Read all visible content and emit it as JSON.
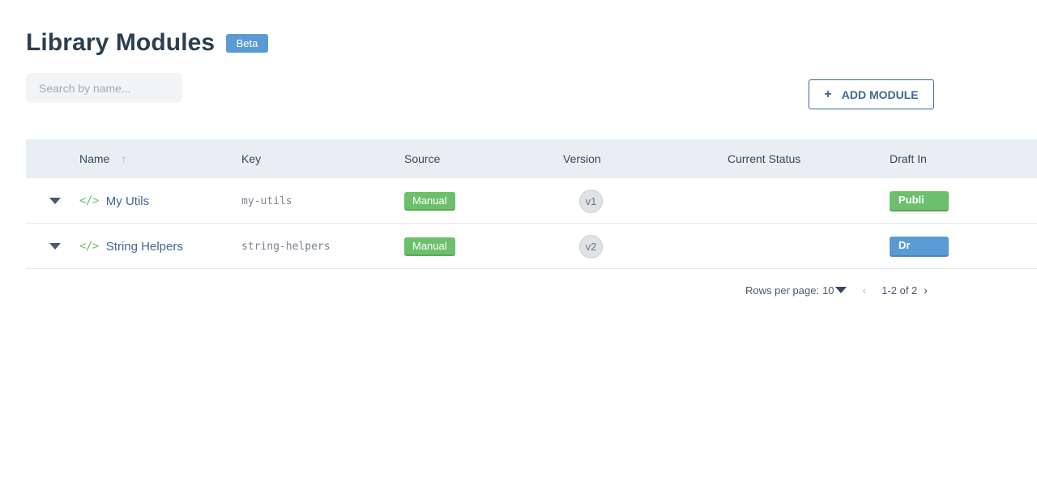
{
  "header": {
    "title": "Library Modules",
    "badge": "Beta"
  },
  "search": {
    "placeholder": "Search by name...",
    "value": ""
  },
  "toolbar": {
    "add_icon": "+",
    "add_label": "ADD MODULE"
  },
  "table": {
    "columns": {
      "name": "Name",
      "sort_icon": "↑",
      "key": "Key",
      "source": "Source",
      "version": "Version",
      "current_status": "Current Status",
      "draft_in": "Draft In"
    },
    "rows": [
      {
        "icon": "</>",
        "name": "My Utils",
        "key": "my-utils",
        "source": "Manual",
        "version": "v1",
        "current_status": "",
        "draft_in": "Publi"
      },
      {
        "icon": "</>",
        "name": "String Helpers",
        "key": "string-helpers",
        "source": "Manual",
        "version": "v2",
        "current_status": "",
        "draft_in": "Dr"
      }
    ]
  },
  "pagination": {
    "rows_per_page_label": "Rows per page:",
    "rows_per_page_value": "10",
    "prev_icon": "‹",
    "range": "1-2 of 2",
    "next_icon": "›"
  },
  "colors": {
    "accent": "#3e6894",
    "beta_badge": "#5b9bd5",
    "tag_green": "#6cc06c",
    "draft_blue": "#5b9bd5"
  }
}
